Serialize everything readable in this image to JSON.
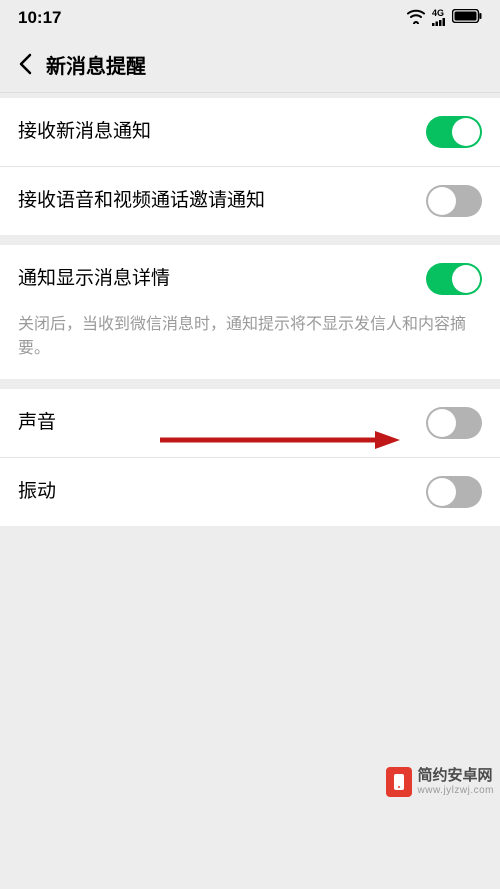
{
  "status": {
    "time": "10:17",
    "signal_4g": "4G"
  },
  "nav": {
    "title": "新消息提醒"
  },
  "group1": {
    "row1": {
      "label": "接收新消息通知",
      "toggle": "on"
    },
    "row2": {
      "label": "接收语音和视频通话邀请通知",
      "toggle": "off"
    }
  },
  "group2": {
    "row1": {
      "label": "通知显示消息详情",
      "toggle": "on"
    },
    "desc": "关闭后，当收到微信消息时，通知提示将不显示发信人和内容摘要。"
  },
  "group3": {
    "row1": {
      "label": "声音",
      "toggle": "off"
    },
    "row2": {
      "label": "振动",
      "toggle": "off"
    }
  },
  "watermark": {
    "line1": "简约安卓网",
    "line2": "www.jylzwj.com"
  }
}
